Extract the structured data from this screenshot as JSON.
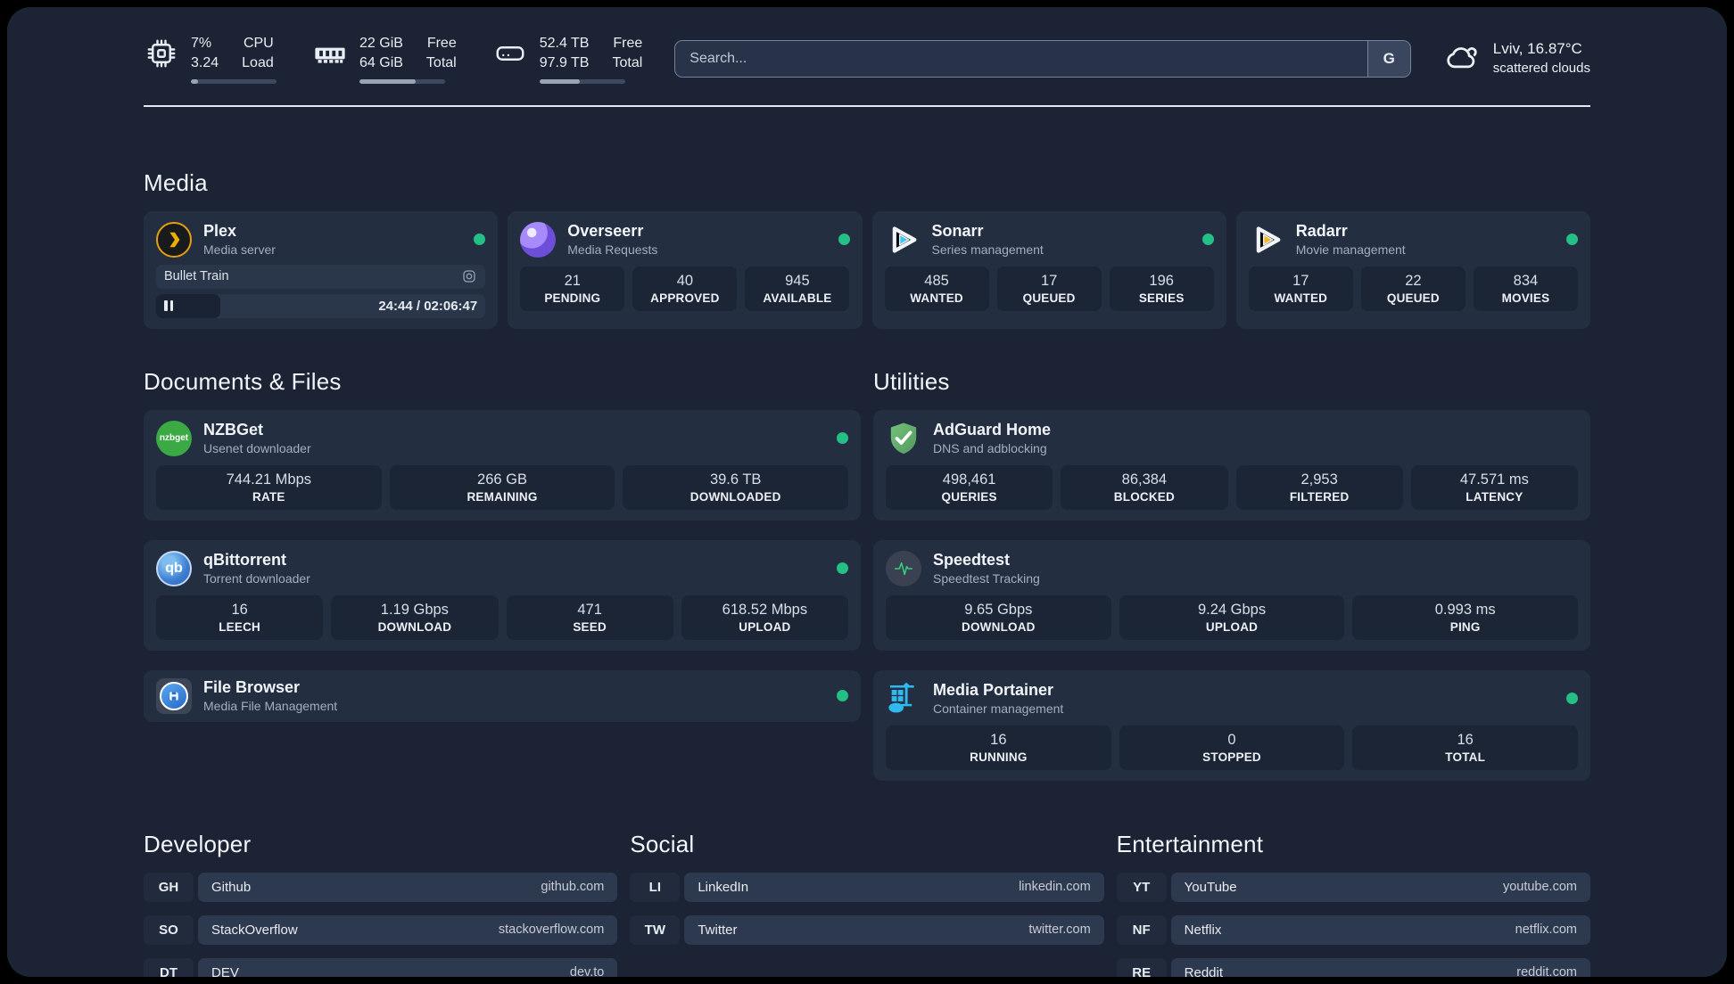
{
  "header": {
    "stats": [
      {
        "icon": "cpu-icon",
        "values": [
          "7%",
          "3.24"
        ],
        "labels": [
          "CPU",
          "Load"
        ],
        "progress_pct": 8
      },
      {
        "icon": "ram-icon",
        "values": [
          "22 GiB",
          "64 GiB"
        ],
        "labels": [
          "Free",
          "Total"
        ],
        "progress_pct": 66
      },
      {
        "icon": "disk-icon",
        "values": [
          "52.4 TB",
          "97.9 TB"
        ],
        "labels": [
          "Free",
          "Total"
        ],
        "progress_pct": 47
      }
    ],
    "search": {
      "placeholder": "Search...",
      "button": "G"
    },
    "weather": {
      "icon": "cloud-icon",
      "location": "Lviv, 16.87°C",
      "condition": "scattered clouds"
    }
  },
  "media": {
    "title": "Media",
    "plex": {
      "name": "Plex",
      "desc": "Media server",
      "icon": "plex-icon",
      "now_playing": "Bullet Train",
      "time": "24:44 / 02:06:47",
      "progress_pct": 19.5
    },
    "overseerr": {
      "name": "Overseerr",
      "desc": "Media Requests",
      "icon": "overseerr-icon",
      "stats": [
        {
          "value": "21",
          "label": "PENDING"
        },
        {
          "value": "40",
          "label": "APPROVED"
        },
        {
          "value": "945",
          "label": "AVAILABLE"
        }
      ]
    },
    "sonarr": {
      "name": "Sonarr",
      "desc": "Series management",
      "icon": "sonarr-play-icon",
      "stats": [
        {
          "value": "485",
          "label": "WANTED"
        },
        {
          "value": "17",
          "label": "QUEUED"
        },
        {
          "value": "196",
          "label": "SERIES"
        }
      ]
    },
    "radarr": {
      "name": "Radarr",
      "desc": "Movie management",
      "icon": "radarr-play-icon",
      "stats": [
        {
          "value": "17",
          "label": "WANTED"
        },
        {
          "value": "22",
          "label": "QUEUED"
        },
        {
          "value": "834",
          "label": "MOVIES"
        }
      ]
    }
  },
  "documents": {
    "title": "Documents & Files",
    "nzbget": {
      "name": "NZBGet",
      "desc": "Usenet downloader",
      "icon": "nzbget-icon",
      "icon_text": "nzbget",
      "stats": [
        {
          "value": "744.21 Mbps",
          "label": "RATE"
        },
        {
          "value": "266 GB",
          "label": "REMAINING"
        },
        {
          "value": "39.6 TB",
          "label": "DOWNLOADED"
        }
      ]
    },
    "qbittorrent": {
      "name": "qBittorrent",
      "desc": "Torrent downloader",
      "icon": "qbittorrent-icon",
      "icon_text": "qb",
      "stats": [
        {
          "value": "16",
          "label": "LEECH"
        },
        {
          "value": "1.19 Gbps",
          "label": "DOWNLOAD"
        },
        {
          "value": "471",
          "label": "SEED"
        },
        {
          "value": "618.52 Mbps",
          "label": "UPLOAD"
        }
      ]
    },
    "filebrowser": {
      "name": "File Browser",
      "desc": "Media File Management",
      "icon": "floppy-disk-icon"
    }
  },
  "utilities": {
    "title": "Utilities",
    "adguard": {
      "name": "AdGuard Home",
      "desc": "DNS and adblocking",
      "icon": "shield-check-icon",
      "stats": [
        {
          "value": "498,461",
          "label": "QUERIES"
        },
        {
          "value": "86,384",
          "label": "BLOCKED"
        },
        {
          "value": "2,953",
          "label": "FILTERED"
        },
        {
          "value": "47.571 ms",
          "label": "LATENCY"
        }
      ]
    },
    "speedtest": {
      "name": "Speedtest",
      "desc": "Speedtest Tracking",
      "icon": "pulse-icon",
      "stats": [
        {
          "value": "9.65 Gbps",
          "label": "DOWNLOAD"
        },
        {
          "value": "9.24 Gbps",
          "label": "UPLOAD"
        },
        {
          "value": "0.993 ms",
          "label": "PING"
        }
      ]
    },
    "portainer": {
      "name": "Media Portainer",
      "desc": "Container management",
      "icon": "crane-containers-icon",
      "stats": [
        {
          "value": "16",
          "label": "RUNNING"
        },
        {
          "value": "0",
          "label": "STOPPED"
        },
        {
          "value": "16",
          "label": "TOTAL"
        }
      ]
    }
  },
  "links": {
    "developer": {
      "title": "Developer",
      "items": [
        {
          "abbr": "GH",
          "name": "Github",
          "url": "github.com"
        },
        {
          "abbr": "SO",
          "name": "StackOverflow",
          "url": "stackoverflow.com"
        },
        {
          "abbr": "DT",
          "name": "DEV",
          "url": "dev.to"
        }
      ]
    },
    "social": {
      "title": "Social",
      "items": [
        {
          "abbr": "LI",
          "name": "LinkedIn",
          "url": "linkedin.com"
        },
        {
          "abbr": "TW",
          "name": "Twitter",
          "url": "twitter.com"
        }
      ]
    },
    "entertainment": {
      "title": "Entertainment",
      "items": [
        {
          "abbr": "YT",
          "name": "YouTube",
          "url": "youtube.com"
        },
        {
          "abbr": "NF",
          "name": "Netflix",
          "url": "netflix.com"
        },
        {
          "abbr": "RE",
          "name": "Reddit",
          "url": "reddit.com"
        }
      ]
    }
  },
  "colors": {
    "background": "#1B2334",
    "card": "#232E41",
    "tile": "#1C2536",
    "status_green": "#23BF85",
    "plex_amber": "#E5A00D",
    "sonarr_blue": "#38C6F4",
    "radarr_yellow": "#F7B52C",
    "portainer_blue": "#2FB9EE",
    "adguard_green": "#67B279",
    "nzbget_green": "#3BAA44",
    "qbittorrent_blue": "#3D7DD1",
    "overseerr_purple": "#7B5CE0"
  }
}
